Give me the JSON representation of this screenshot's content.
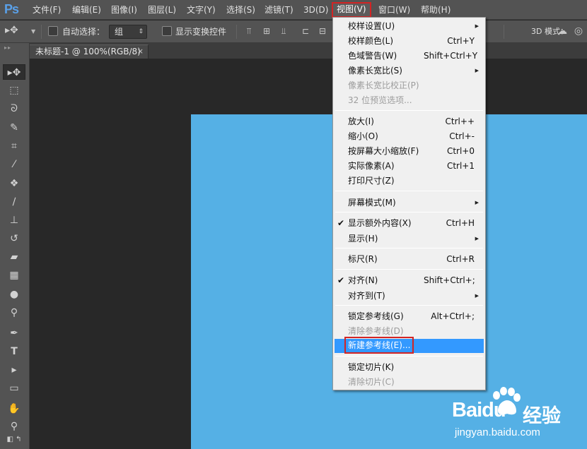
{
  "app": {
    "logo": "Ps"
  },
  "menubar": {
    "items": [
      "文件(F)",
      "编辑(E)",
      "图像(I)",
      "图层(L)",
      "文字(Y)",
      "选择(S)",
      "滤镜(T)",
      "3D(D)",
      "视图(V)",
      "窗口(W)",
      "帮助(H)"
    ],
    "active_item": "视图(V)"
  },
  "options_bar": {
    "auto_select_label": "自动选择：",
    "auto_select_checked": false,
    "auto_select_value": "组",
    "show_transform_label": "显示变换控件",
    "show_transform_checked": false,
    "mode_3d_label": "3D 模式："
  },
  "document": {
    "tab_title": "未标题-1 @ 100%(RGB/8)",
    "tab_close": "×",
    "canvas_color": "#55b0e5"
  },
  "view_menu": {
    "items": [
      {
        "label": "校样设置(U)",
        "submenu": true
      },
      {
        "label": "校样颜色(L)",
        "shortcut": "Ctrl+Y"
      },
      {
        "label": "色域警告(W)",
        "shortcut": "Shift+Ctrl+Y"
      },
      {
        "label": "像素长宽比(S)",
        "submenu": true
      },
      {
        "label": "像素长宽比校正(P)",
        "disabled": true
      },
      {
        "label": "32 位预览选项...",
        "disabled": true
      },
      {
        "label": "放大(I)",
        "shortcut": "Ctrl++"
      },
      {
        "label": "缩小(O)",
        "shortcut": "Ctrl+-"
      },
      {
        "label": "按屏幕大小缩放(F)",
        "shortcut": "Ctrl+0"
      },
      {
        "label": "实际像素(A)",
        "shortcut": "Ctrl+1"
      },
      {
        "label": "打印尺寸(Z)"
      },
      {
        "label": "屏幕模式(M)",
        "submenu": true
      },
      {
        "label": "显示额外内容(X)",
        "shortcut": "Ctrl+H",
        "checked": true
      },
      {
        "label": "显示(H)",
        "submenu": true
      },
      {
        "label": "标尺(R)",
        "shortcut": "Ctrl+R"
      },
      {
        "label": "对齐(N)",
        "shortcut": "Shift+Ctrl+;",
        "checked": true
      },
      {
        "label": "对齐到(T)",
        "submenu": true
      },
      {
        "label": "锁定参考线(G)",
        "shortcut": "Alt+Ctrl+;"
      },
      {
        "label": "清除参考线(D)",
        "disabled": true
      },
      {
        "label": "新建参考线(E)...",
        "highlighted": true
      },
      {
        "label": "锁定切片(K)"
      },
      {
        "label": "清除切片(C)",
        "disabled": true
      }
    ],
    "checkmark": "✔",
    "submenu_arrow": "▶"
  },
  "watermark": {
    "brand": "Bai",
    "brand_suffix": "du",
    "product": "经验",
    "url": "jingyan.baidu.com"
  },
  "colors": {
    "accent": "#3399ff",
    "highlight_border": "#d32424",
    "ps_blue": "#5aa0e8",
    "canvas": "#55b0e5"
  },
  "icons": {
    "toolbox": [
      "move-icon",
      "marquee-icon",
      "lasso-icon",
      "quick-select-icon",
      "crop-icon",
      "eyedropper-icon",
      "healing-brush-icon",
      "brush-icon",
      "clone-stamp-icon",
      "history-brush-icon",
      "eraser-icon",
      "gradient-icon",
      "blur-icon",
      "dodge-icon",
      "pen-icon",
      "type-icon",
      "path-select-icon",
      "rectangle-icon",
      "hand-icon",
      "zoom-icon"
    ]
  }
}
